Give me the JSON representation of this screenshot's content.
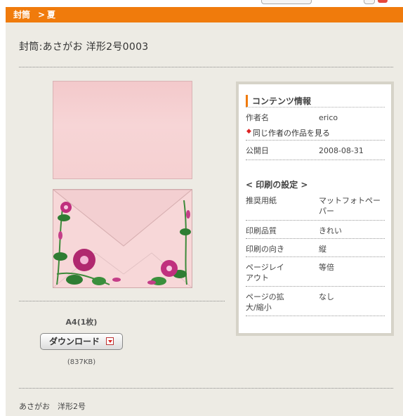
{
  "breadcrumb": {
    "first": "封筒",
    "separator": ">",
    "second": "夏"
  },
  "page_title": "封筒:あさがお 洋形2号0003",
  "download": {
    "size_label": "A4(1枚)",
    "button_label": "ダウンロード",
    "file_size": "(837KB)"
  },
  "info": {
    "contents_heading": "コンテンツ情報",
    "author_label": "作者名",
    "author_value": "erico",
    "same_author_link": "同じ作者の作品を見る",
    "published_label": "公開日",
    "published_value": "2008-08-31",
    "print_heading": "< 印刷の設定 >",
    "rows": [
      {
        "label": "推奨用紙",
        "value": "マットフォトペーパー"
      },
      {
        "label": "印刷品質",
        "value": "きれい"
      },
      {
        "label": "印刷の向き",
        "value": "縦"
      },
      {
        "label": "ページレイアウト",
        "value": "等倍"
      },
      {
        "label": "ページの拡大/縮小",
        "value": "なし"
      }
    ]
  },
  "footer_text": "あさがお　洋形2号",
  "colors": {
    "accent": "#f07b0c",
    "background": "#edebe4",
    "box_border": "#d6d3c8"
  }
}
